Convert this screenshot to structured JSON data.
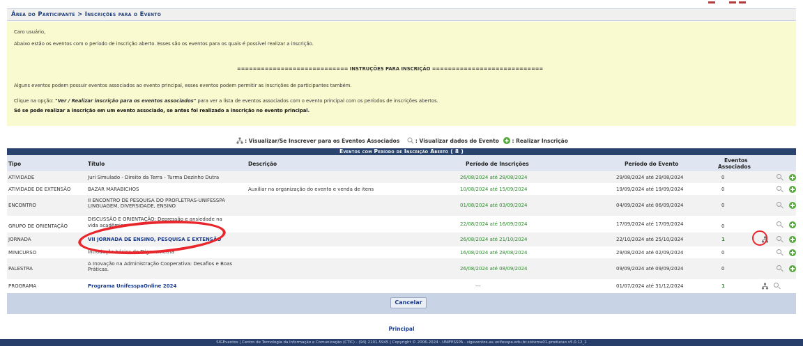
{
  "breadcrumb": "Área do Participante > Inscrições para o Evento",
  "notice": {
    "greeting": "Caro usuário,",
    "line1": "Abaixo estão os eventos com o período de inscrição aberto. Esses são os eventos para os quais é possível realizar a inscrição.",
    "instructions_header": "============================ INSTRUÇÕES PARA INSCRIÇÃO ============================",
    "line2": "Alguns eventos podem possuir eventos associados ao evento principal, esses eventos podem permitir as inscrições de participantes também.",
    "line3_prefix": "Clique na opção: ",
    "line3_option": "\"Ver / Realizar inscrição para os eventos associados\"",
    "line3_suffix": " para ver a lista de eventos associados com o evento principal com os períodos de inscrições abertos.",
    "line4": "Só se pode realizar a inscrição em um evento associado, se antes foi realizado a inscrição no evento principal."
  },
  "legend": {
    "assoc": ": Visualizar/Se Inscrever para os Eventos Associados",
    "view": ": Visualizar dados do Evento",
    "enroll": ": Realizar Inscrição"
  },
  "table": {
    "caption": "Eventos com Período de Inscrição Aberto ( 8 )",
    "headers": {
      "tipo": "Tipo",
      "titulo": "Título",
      "descricao": "Descrição",
      "periodo_inscricoes": "Período de Inscrições",
      "periodo_evento": "Período do Evento",
      "eventos_associados_1": "Eventos",
      "eventos_associados_2": "Associados"
    },
    "rows": [
      {
        "tipo": "ATIVIDADE",
        "titulo": "Juri Simulado - Direito da Terra - Turma Dezinho Dutra",
        "titulo2": "",
        "descricao": "",
        "inscricoes": "26/08/2024 até 28/08/2024",
        "evento": "29/08/2024 até 29/08/2024",
        "associados": "0"
      },
      {
        "tipo": "ATIVIDADE DE EXTENSÃO",
        "titulo": "BAZAR MARABICHOS",
        "titulo2": "",
        "descricao": "Auxiliar na organização do evento e venda de itens",
        "inscricoes": "10/08/2024 até 15/09/2024",
        "evento": "19/09/2024 até 19/09/2024",
        "associados": "0"
      },
      {
        "tipo": "ENCONTRO",
        "titulo": "II ENCONTRO DE PESQUISA DO PROFLETRAS-UNIFESSPA",
        "titulo2": "LINGUAGEM, DIVERSIDADE, ENSINO",
        "descricao": "",
        "inscricoes": "01/08/2024 até 03/09/2024",
        "evento": "04/09/2024 até 06/09/2024",
        "associados": "0"
      },
      {
        "tipo": "GRUPO DE ORIENTAÇÃO",
        "titulo": "DISCUSSÃO E ORIENTAÇÃO: Depressão e ansiedade na",
        "titulo2": "vida acadêmica",
        "descricao": "",
        "inscricoes": "22/08/2024 até 16/09/2024",
        "evento": "17/09/2024 até 17/09/2024",
        "associados": "0"
      },
      {
        "tipo": "JORNADA",
        "titulo": "VII JORNADA DE ENSINO, PESQUISA E EXTENSÃO",
        "titulo2": "",
        "descricao": "",
        "inscricoes": "26/08/2024 até 21/10/2024",
        "evento": "22/10/2024 até 25/10/2024",
        "associados": "1"
      },
      {
        "tipo": "MINICURSO",
        "titulo": "Introdução básica de Trigonometria",
        "titulo2": "",
        "descricao": "",
        "inscricoes": "16/08/2024 até 28/08/2024",
        "evento": "29/08/2024 até 02/09/2024",
        "associados": "0"
      },
      {
        "tipo": "PALESTRA",
        "titulo": "A Inovação na Administração Cooperativa: Desafios e Boas",
        "titulo2": "Práticas.",
        "descricao": "",
        "inscricoes": "26/08/2024 até 08/09/2024",
        "evento": "09/09/2024 até 09/09/2024",
        "associados": "0"
      },
      {
        "tipo": "PROGRAMA",
        "titulo": "Programa UnifesspaOnline 2024",
        "titulo2": "",
        "descricao": "",
        "inscricoes": "---",
        "evento": "01/07/2024 até 31/12/2024",
        "associados": "1"
      }
    ]
  },
  "cancel_label": "Cancelar",
  "principal_link": "Principal",
  "footer": "SIGEventos | Centro de Tecnologia da Informação e Comunicação (CTIC) - (94) 2101-5945 | Copyright © 2006-2024 - UNIFESSPA - sigeventos-as.unifesspa.edu.br.sistema01-producao v5.0.12_1",
  "colors": {
    "header_bar": "#27436e",
    "notice_bg": "#fafad0",
    "link_blue": "#1a3c8f",
    "date_green": "#2d8a2d",
    "annotation_red": "#e8262b"
  }
}
